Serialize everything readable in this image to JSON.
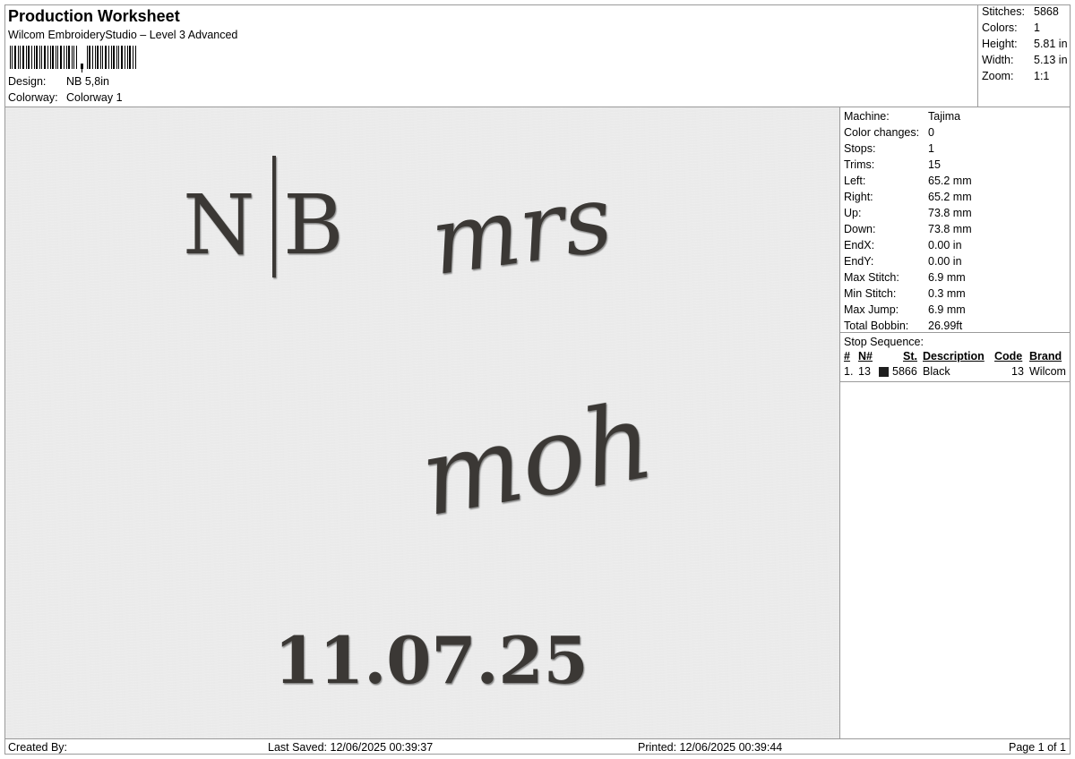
{
  "header": {
    "title": "Production Worksheet",
    "subtitle": "Wilcom EmbroideryStudio – Level 3 Advanced",
    "design_label": "Design:",
    "design_value": "NB 5,8in",
    "colorway_label": "Colorway:",
    "colorway_value": "Colorway 1"
  },
  "summary": {
    "stitches_label": "Stitches:",
    "stitches_value": "5868",
    "colors_label": "Colors:",
    "colors_value": "1",
    "height_label": "Height:",
    "height_value": "5.81 in",
    "width_label": "Width:",
    "width_value": "5.13 in",
    "zoom_label": "Zoom:",
    "zoom_value": "1:1"
  },
  "details": [
    {
      "label": "Machine:",
      "value": "Tajima"
    },
    {
      "label": "Color changes:",
      "value": "0"
    },
    {
      "label": "Stops:",
      "value": "1"
    },
    {
      "label": "Trims:",
      "value": "15"
    },
    {
      "label": "Left:",
      "value": "65.2 mm"
    },
    {
      "label": "Right:",
      "value": "65.2 mm"
    },
    {
      "label": "Up:",
      "value": "73.8 mm"
    },
    {
      "label": "Down:",
      "value": "73.8 mm"
    },
    {
      "label": "EndX:",
      "value": "0.00 in"
    },
    {
      "label": "EndY:",
      "value": "0.00 in"
    },
    {
      "label": "Max Stitch:",
      "value": "6.9 mm"
    },
    {
      "label": "Min Stitch:",
      "value": "0.3 mm"
    },
    {
      "label": "Max Jump:",
      "value": "6.9 mm"
    },
    {
      "label": "Total Bobbin:",
      "value": "26.99ft"
    }
  ],
  "stop_sequence": {
    "title": "Stop Sequence:",
    "columns": [
      "#",
      "N#",
      "St.",
      "Description",
      "Code",
      "Brand"
    ],
    "rows": [
      {
        "index": "1.",
        "needle": "13",
        "swatch_color": "#1e1e1e",
        "stitches": "5866",
        "description": "Black",
        "code": "13",
        "brand": "Wilcom"
      }
    ]
  },
  "design": {
    "monogram_left": "N",
    "monogram_right": "B",
    "script_top": "mrs",
    "script_bottom": "moh",
    "date": "11.07.25",
    "thread_color": "#3a3935"
  },
  "footer": {
    "created_by": "Created By:",
    "last_saved": "Last Saved: 12/06/2025 00:39:37",
    "printed": "Printed: 12/06/2025 00:39:44",
    "page": "Page 1 of 1"
  }
}
